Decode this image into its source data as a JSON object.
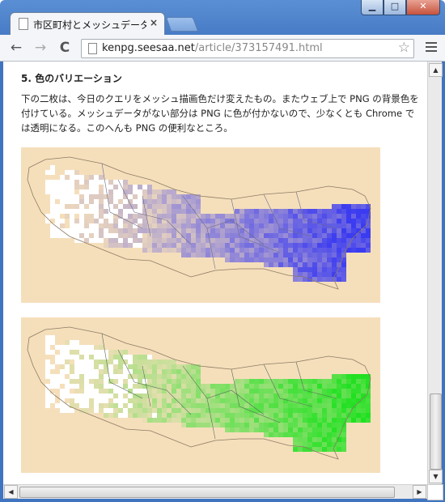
{
  "window": {
    "controls": [
      "▁",
      "□",
      "✕"
    ]
  },
  "tab": {
    "title": "市区町村とメッシュデータを重",
    "close": "×"
  },
  "toolbar": {
    "back": "←",
    "forward": "→",
    "reload": "C",
    "url_host": "kenpg.seesaa.net",
    "url_path": "/article/373157491.html",
    "star": "☆"
  },
  "article": {
    "heading": "5. 色のバリエーション",
    "paragraph": "下の二枚は、今日のクエリをメッシュ描画色だけ変えたもの。またウェブ上で PNG の背景色を付けている。メッシュデータがない部分は PNG に色が付かないので、少なくとも Chrome では透明になる。このへんも PNG の便利なところ。"
  },
  "maps": [
    {
      "background": "#f5dfbb",
      "mesh_color": "#3b3bf0"
    },
    {
      "background": "#f5dfbb",
      "mesh_color": "#21e021"
    }
  ],
  "scrollbar": {
    "up": "▲",
    "down": "▼",
    "left": "◀",
    "right": "▶"
  }
}
